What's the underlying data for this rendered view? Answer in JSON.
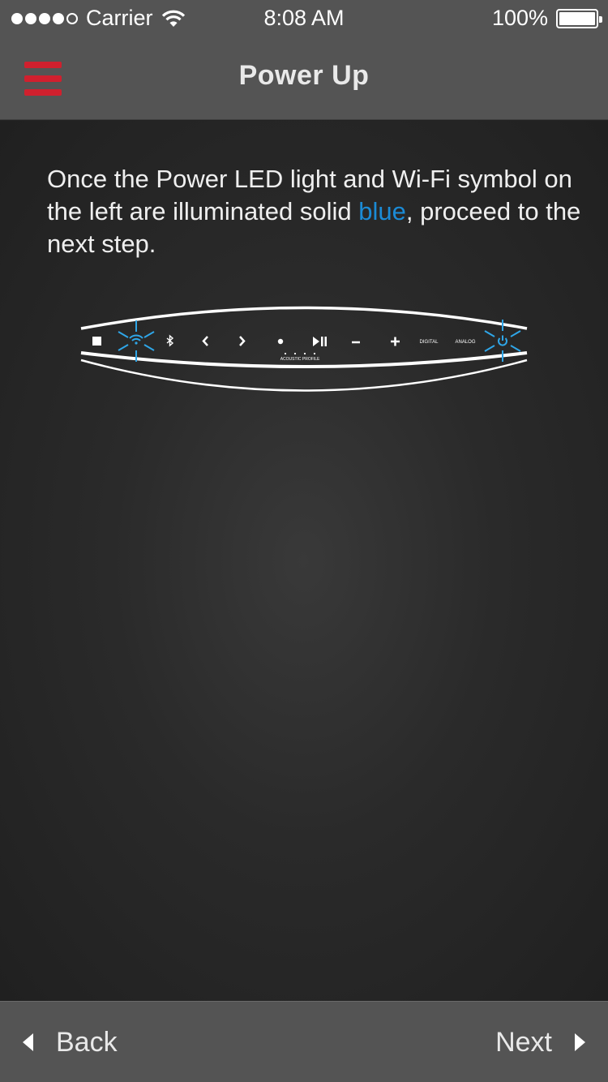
{
  "status_bar": {
    "signal_filled": 4,
    "signal_total": 5,
    "carrier": "Carrier",
    "time": "8:08 AM",
    "battery_percent": "100%",
    "battery_level": 1.0
  },
  "nav": {
    "title": "Power Up",
    "menu_icon": "hamburger-menu-icon",
    "menu_color": "#d0202e"
  },
  "content": {
    "instruction_before": "Once the Power LED light and Wi-Fi symbol on the left are illuminated solid ",
    "instruction_highlight": "blue",
    "instruction_after": ", proceed to the next step.",
    "highlight_color": "#1b8bd6",
    "device": {
      "acoustic_profile_label": "ACOUSTIC PROFILE",
      "digital_label": "DIGITAL",
      "analog_label": "ANALOG",
      "lit_icons": [
        "wifi-icon",
        "power-icon"
      ],
      "led_color": "#2fa6e8"
    }
  },
  "bottom_bar": {
    "back_label": "Back",
    "next_label": "Next"
  }
}
